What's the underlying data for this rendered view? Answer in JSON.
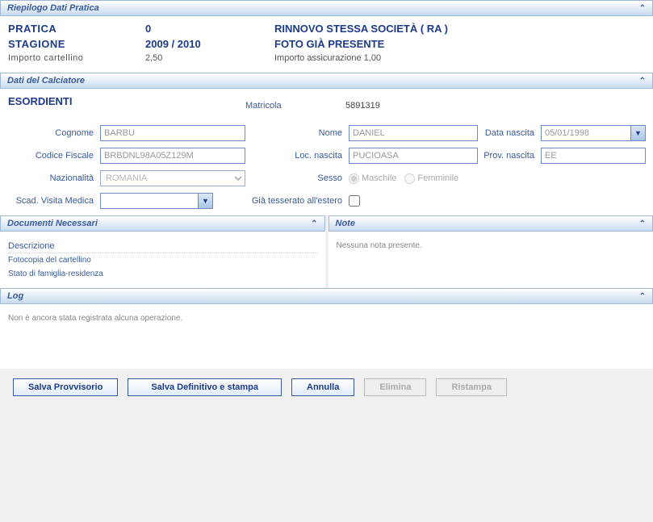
{
  "summary": {
    "header": "Riepilogo Dati Pratica",
    "pratica_label": "PRATICA",
    "pratica_value": "0",
    "operation": "RINNOVO STESSA SOCIETÀ  ( RA )",
    "stagione_label": "STAGIONE",
    "stagione_value": "2009 / 2010",
    "foto_status": "FOTO GIÀ PRESENTE",
    "importo_cart_label": "Importo cartellino",
    "importo_cart_value": "2,50",
    "importo_ass": "Importo assicurazione 1,00"
  },
  "player": {
    "header": "Dati del Calciatore",
    "category": "ESORDIENTI",
    "matricola_label": "Matricola",
    "matricola_value": "5891319",
    "cognome_label": "Cognome",
    "cognome_value": "BARBU",
    "nome_label": "Nome",
    "nome_value": "DANIEL",
    "data_nascita_label": "Data nascita",
    "data_nascita_value": "05/01/1998",
    "cf_label": "Codice Fiscale",
    "cf_value": "BRBDNL98A05Z129M",
    "loc_nascita_label": "Loc. nascita",
    "loc_nascita_value": "PUCIOASA",
    "prov_nascita_label": "Prov. nascita",
    "prov_nascita_value": "EE",
    "nazionalita_label": "Nazionalità",
    "nazionalita_value": "ROMANIA",
    "sesso_label": "Sesso",
    "sesso_m": "Maschile",
    "sesso_f": "Femminile",
    "scad_label": "Scad. Visita Medica",
    "scad_value": "",
    "tesserato_label": "Già tesserato all'estero"
  },
  "docs": {
    "header": "Documenti Necessari",
    "desc_label": "Descrizione",
    "items": [
      "Fotocopia del cartellino",
      "Stato di famiglia-residenza"
    ]
  },
  "notes": {
    "header": "Note",
    "empty": "Nessuna nota presente."
  },
  "log": {
    "header": "Log",
    "empty": "Non è ancora stata registrata alcuna operazione."
  },
  "buttons": {
    "salva_prov": "Salva Provvisorio",
    "salva_def": "Salva Definitivo e stampa",
    "annulla": "Annulla",
    "elimina": "Elimina",
    "ristampa": "Ristampa"
  }
}
